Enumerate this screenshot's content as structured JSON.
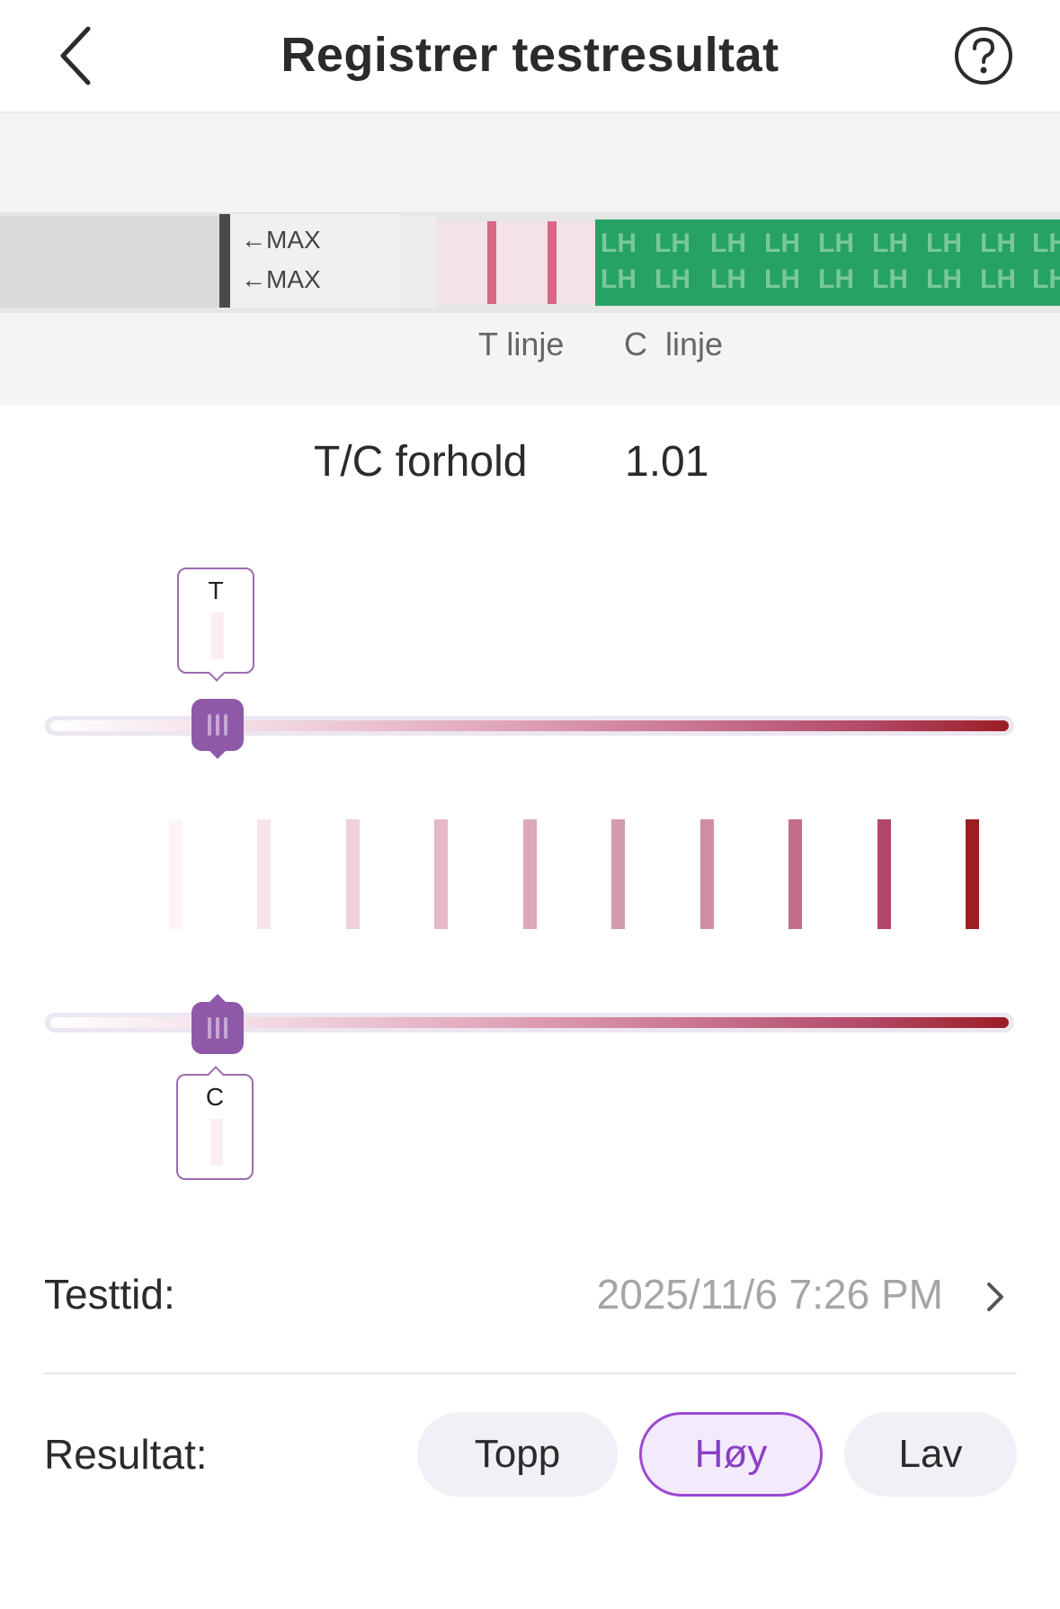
{
  "header": {
    "title": "Registrer testresultat",
    "back_icon": "chevron-left-icon",
    "help_icon": "question-circle-icon"
  },
  "strip": {
    "max_arrow_1": "←MAX",
    "max_arrow_2": "←MAX",
    "band_text": "LH",
    "t_line_label": "T linje",
    "c_line_label": "C  linje"
  },
  "ratio": {
    "label": "T/C forhold",
    "value": "1.01"
  },
  "sliders": {
    "t_label": "T",
    "c_label": "C",
    "t_level_step": 2,
    "c_level_step": 2,
    "steps_total": 10
  },
  "swatch_colors": [
    "#fdf4f6",
    "#f7e3e9",
    "#f0d0da",
    "#e6b9c8",
    "#dda8ba",
    "#d49aaf",
    "#cf8da4",
    "#c36d8a",
    "#b1476a",
    "#9c1d24"
  ],
  "test_time": {
    "label": "Testtid:",
    "value": "2025/11/6 7:26 PM",
    "chevron_icon": "chevron-right-icon"
  },
  "result": {
    "label": "Resultat:",
    "options": [
      "Topp",
      "Høy",
      "Lav"
    ],
    "selected": "Høy"
  },
  "colors": {
    "accent": "#8e5aa8",
    "selected_border": "#9c49d3",
    "strip_green": "#27a265",
    "test_line": "#d86886"
  }
}
